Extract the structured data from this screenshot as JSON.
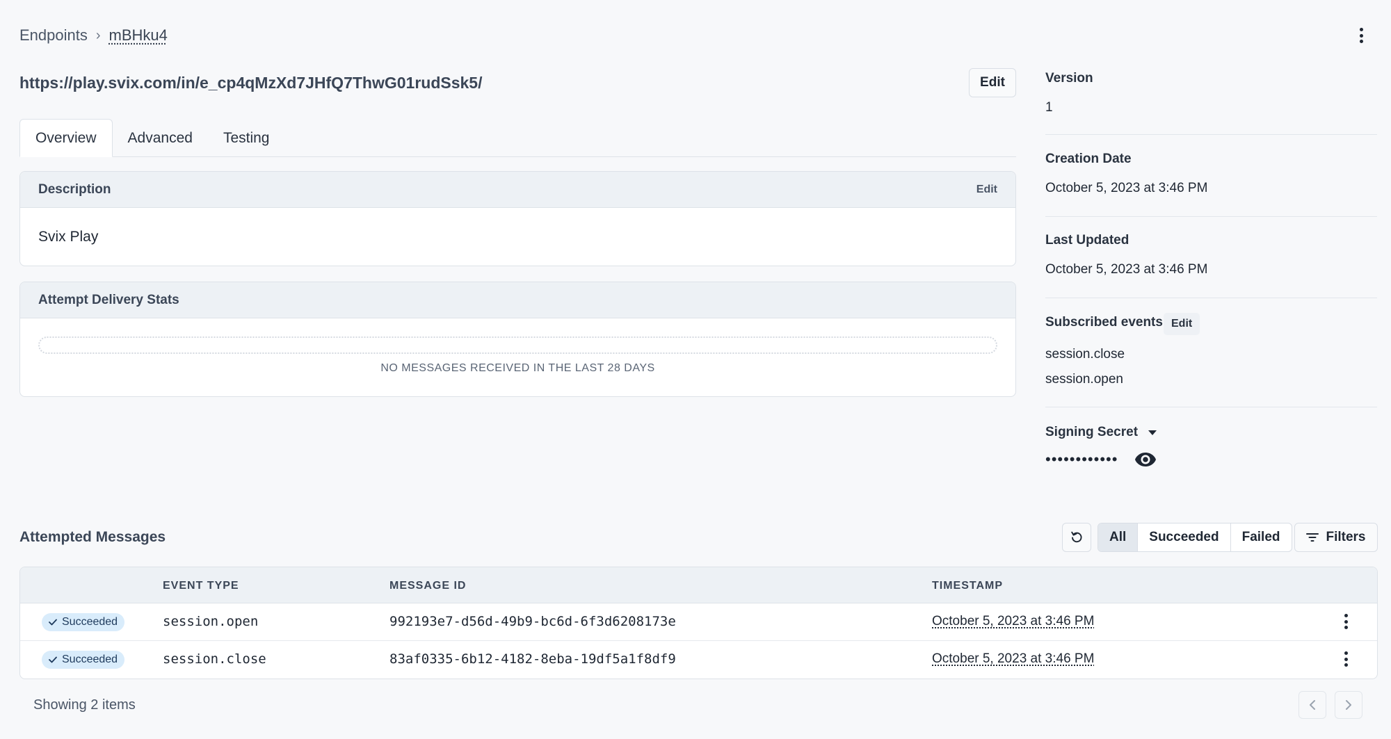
{
  "breadcrumb": {
    "root": "Endpoints",
    "separator": "›",
    "current": "mBHku4"
  },
  "endpoint": {
    "url": "https://play.svix.com/in/e_cp4qMzXd7JHfQ7ThwG01rudSsk5/",
    "edit_label": "Edit"
  },
  "tabs": [
    {
      "label": "Overview",
      "active": true
    },
    {
      "label": "Advanced",
      "active": false
    },
    {
      "label": "Testing",
      "active": false
    }
  ],
  "description_card": {
    "title": "Description",
    "edit_label": "Edit",
    "body": "Svix Play"
  },
  "stats_card": {
    "title": "Attempt Delivery Stats",
    "empty_text": "NO MESSAGES RECEIVED IN THE LAST 28 DAYS"
  },
  "sidebar": {
    "version": {
      "label": "Version",
      "value": "1"
    },
    "creation_date": {
      "label": "Creation Date",
      "value": "October 5, 2023 at 3:46 PM"
    },
    "last_updated": {
      "label": "Last Updated",
      "value": "October 5, 2023 at 3:46 PM"
    },
    "subscribed_events": {
      "label": "Subscribed events",
      "edit_label": "Edit",
      "items": [
        "session.close",
        "session.open"
      ]
    },
    "signing_secret": {
      "label": "Signing Secret",
      "masked": "••••••••••••",
      "reveal_icon": "eye-icon"
    }
  },
  "attempted_messages": {
    "title": "Attempted Messages",
    "refresh_icon": "refresh-icon",
    "filter_segments": [
      {
        "label": "All",
        "active": true
      },
      {
        "label": "Succeeded",
        "active": false
      },
      {
        "label": "Failed",
        "active": false
      }
    ],
    "filters_label": "Filters",
    "columns": [
      "",
      "EVENT TYPE",
      "MESSAGE ID",
      "TIMESTAMP"
    ],
    "rows": [
      {
        "status": "Succeeded",
        "event_type": "session.open",
        "message_id": "992193e7-d56d-49b9-bc6d-6f3d6208173e",
        "timestamp": "October 5, 2023 at 3:46 PM"
      },
      {
        "status": "Succeeded",
        "event_type": "session.close",
        "message_id": "83af0335-6b12-4182-8eba-19df5a1f8df9",
        "timestamp": "October 5, 2023 at 3:46 PM"
      }
    ],
    "footer": "Showing 2 items"
  },
  "colors": {
    "background": "#f7f8fa",
    "header_bg": "#edf1f5",
    "badge_bg": "#d9ecfb",
    "text": "#1f2733"
  }
}
